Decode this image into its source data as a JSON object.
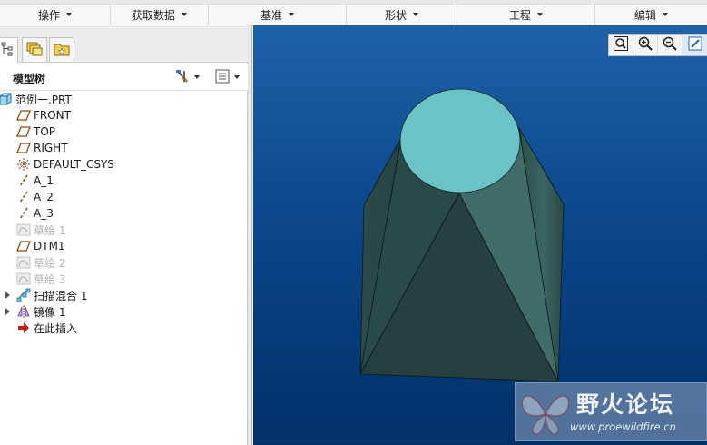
{
  "ribbon": {
    "groups": [
      {
        "label": "操作"
      },
      {
        "label": "获取数据"
      },
      {
        "label": "基准"
      },
      {
        "label": "形状"
      },
      {
        "label": "工程"
      },
      {
        "label": "编辑"
      }
    ]
  },
  "panel": {
    "tabs": [
      {
        "icon": "model-tree-tab-icon"
      },
      {
        "icon": "folder-browser-tab-icon"
      },
      {
        "icon": "favorites-tab-icon"
      }
    ],
    "tree_title": "模型树",
    "settings_icon": "tree-settings-icon",
    "show_icon": "tree-columns-icon"
  },
  "tree": {
    "items": [
      {
        "label": "范例一.PRT",
        "icon": "part-icon",
        "dim": false,
        "expandable": false
      },
      {
        "label": "FRONT",
        "icon": "datum-plane-icon",
        "dim": false,
        "expandable": false
      },
      {
        "label": "TOP",
        "icon": "datum-plane-icon",
        "dim": false,
        "expandable": false
      },
      {
        "label": "RIGHT",
        "icon": "datum-plane-icon",
        "dim": false,
        "expandable": false
      },
      {
        "label": "DEFAULT_CSYS",
        "icon": "csys-icon",
        "dim": false,
        "expandable": false
      },
      {
        "label": "A_1",
        "icon": "datum-axis-icon",
        "dim": false,
        "expandable": false
      },
      {
        "label": "A_2",
        "icon": "datum-axis-icon",
        "dim": false,
        "expandable": false
      },
      {
        "label": "A_3",
        "icon": "datum-axis-icon",
        "dim": false,
        "expandable": false
      },
      {
        "label": "草绘 1",
        "icon": "sketch-icon",
        "dim": true,
        "expandable": false
      },
      {
        "label": "DTM1",
        "icon": "datum-plane-icon",
        "dim": false,
        "expandable": false
      },
      {
        "label": "草绘 2",
        "icon": "sketch-icon",
        "dim": true,
        "expandable": false
      },
      {
        "label": "草绘 3",
        "icon": "sketch-icon",
        "dim": true,
        "expandable": false
      },
      {
        "label": "扫描混合 1",
        "icon": "swept-blend-icon",
        "dim": false,
        "expandable": true
      },
      {
        "label": "镜像 1",
        "icon": "mirror-icon",
        "dim": false,
        "expandable": true
      },
      {
        "label": "在此插入",
        "icon": "insert-here-arrow-icon",
        "dim": false,
        "expandable": false
      }
    ]
  },
  "viewport": {
    "tools": [
      {
        "icon": "refit-icon"
      },
      {
        "icon": "zoom-in-icon"
      },
      {
        "icon": "zoom-out-icon"
      },
      {
        "icon": "repaint-icon"
      }
    ],
    "watermark_title": "野火论坛",
    "watermark_url": "www.proewildfire.cn"
  },
  "colors": {
    "face_top": "#6cc3c6",
    "body": "#2a4b4a",
    "viewport_top": "#1e62a8",
    "viewport_bottom": "#02306a"
  }
}
